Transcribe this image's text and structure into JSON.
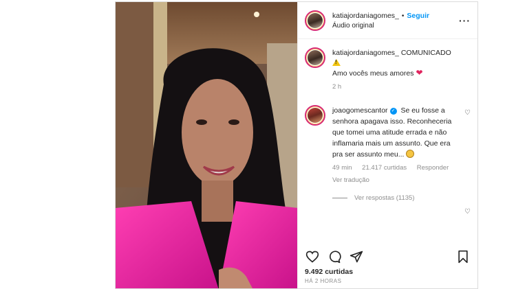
{
  "post": {
    "author": "katiajordaniagomes_",
    "dot": "•",
    "follow_label": "Seguir",
    "audio_label": "Áudio original",
    "more_icon": "more-horizontal-icon"
  },
  "caption": {
    "user": "katiajordaniagomes_",
    "text": "COMUNICADO",
    "line2": "Amo vocês meus amores",
    "emoji_warning": "warning-icon",
    "emoji_heart": "❤",
    "time": "2 h"
  },
  "comment": {
    "user": "joaogomescantor",
    "verified_mark": "✓",
    "text": "Se eu fosse a senhora apagava isso. Reconheceria que tomei uma atitude errada e não inflamaria mais um assunto. Que era pra ser assunto meu...",
    "time": "49 min",
    "likes": "21.417 curtidas",
    "reply_label": "Responder",
    "translation_label": "Ver tradução",
    "view_replies": "Ver respostas (1135)"
  },
  "footer": {
    "likes_count": "9.492 curtidas",
    "posted_ago": "HÁ 2 HORAS"
  },
  "colors": {
    "accent": "#0095f6",
    "heart": "#e0245e",
    "muted": "#8e8e8e"
  }
}
